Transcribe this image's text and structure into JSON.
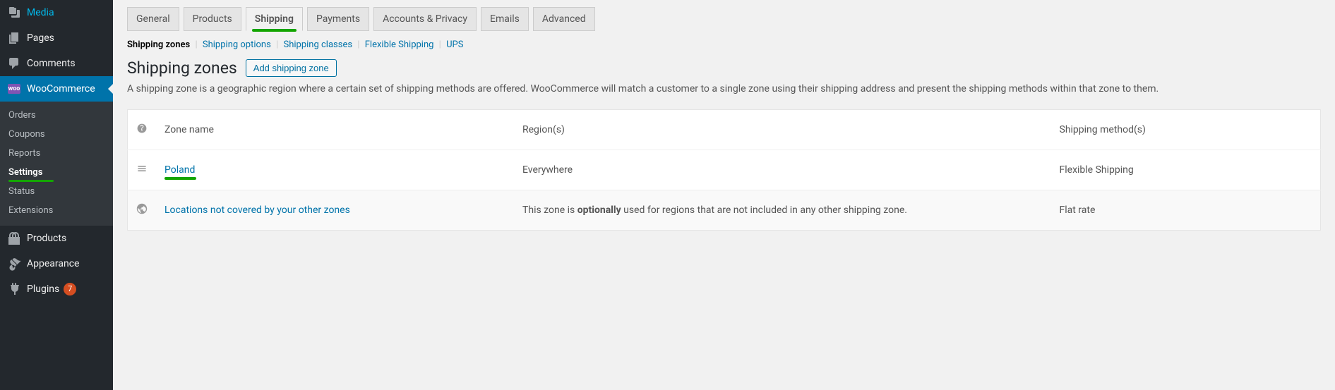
{
  "sidebar": {
    "items": [
      {
        "label": "Media",
        "icon": "media-icon"
      },
      {
        "label": "Pages",
        "icon": "page-icon"
      },
      {
        "label": "Comments",
        "icon": "comment-icon"
      },
      {
        "label": "WooCommerce",
        "icon": "woo-icon",
        "current": true
      },
      {
        "label": "Products",
        "icon": "product-icon"
      },
      {
        "label": "Appearance",
        "icon": "appearance-icon"
      },
      {
        "label": "Plugins",
        "icon": "plugin-icon",
        "badge": "7"
      }
    ],
    "submenu": [
      {
        "label": "Orders"
      },
      {
        "label": "Coupons"
      },
      {
        "label": "Reports"
      },
      {
        "label": "Settings",
        "current": true
      },
      {
        "label": "Status"
      },
      {
        "label": "Extensions"
      }
    ]
  },
  "tabs": [
    {
      "label": "General"
    },
    {
      "label": "Products"
    },
    {
      "label": "Shipping",
      "active": true
    },
    {
      "label": "Payments"
    },
    {
      "label": "Accounts & Privacy"
    },
    {
      "label": "Emails"
    },
    {
      "label": "Advanced"
    }
  ],
  "subtabs": [
    {
      "label": "Shipping zones",
      "current": true
    },
    {
      "label": "Shipping options"
    },
    {
      "label": "Shipping classes"
    },
    {
      "label": "Flexible Shipping"
    },
    {
      "label": "UPS"
    }
  ],
  "page": {
    "title": "Shipping zones",
    "add_button": "Add shipping zone",
    "description": "A shipping zone is a geographic region where a certain set of shipping methods are offered. WooCommerce will match a customer to a single zone using their shipping address and present the shipping methods within that zone to them."
  },
  "table": {
    "headers": {
      "name": "Zone name",
      "region": "Region(s)",
      "method": "Shipping method(s)"
    },
    "rows": [
      {
        "name": "Poland",
        "region": "Everywhere",
        "method": "Flexible Shipping",
        "highlight": true
      }
    ],
    "fallback": {
      "name": "Locations not covered by your other zones",
      "region_pre": "This zone is ",
      "region_strong": "optionally",
      "region_post": " used for regions that are not included in any other shipping zone.",
      "method": "Flat rate"
    }
  },
  "woo_badge": "woo"
}
